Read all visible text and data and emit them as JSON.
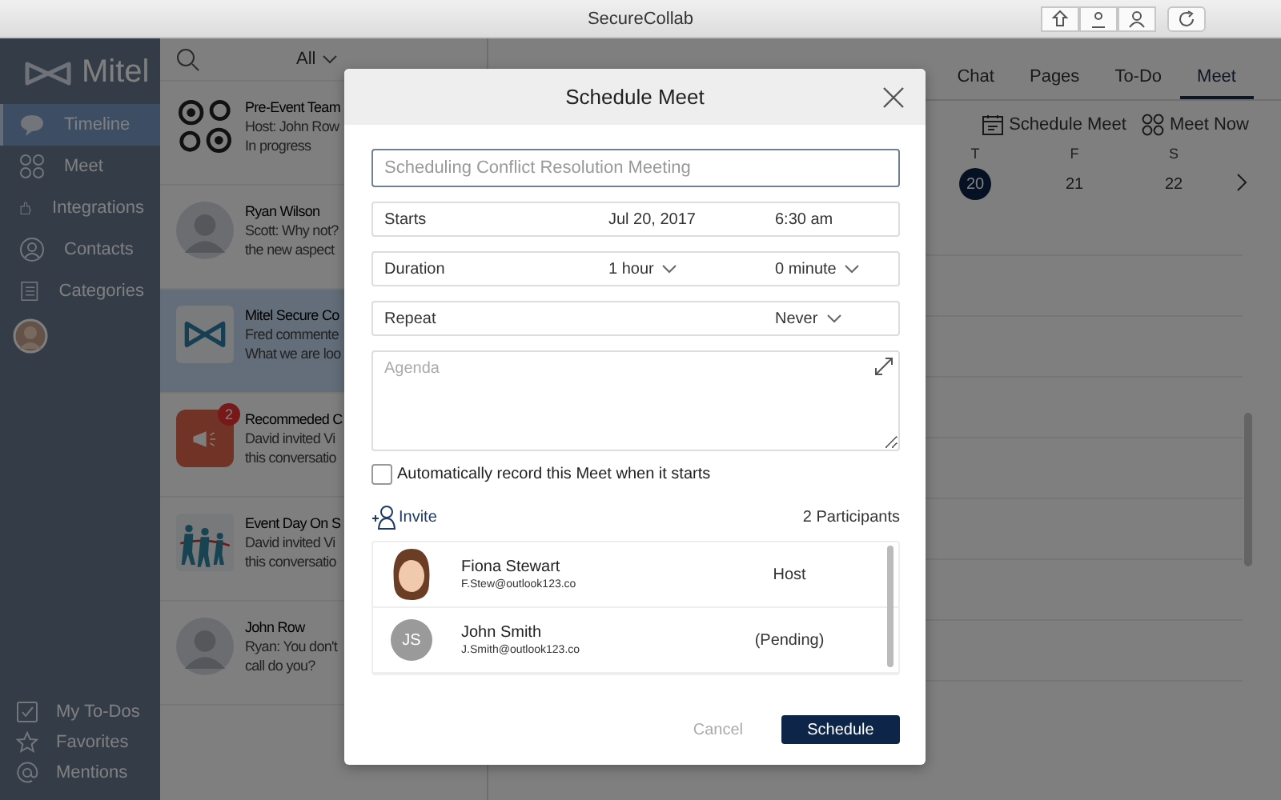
{
  "window": {
    "title": "SecureCollab"
  },
  "sidebar": {
    "logo": "Mitel",
    "items": [
      {
        "label": "Timeline",
        "selected": true
      },
      {
        "label": "Meet",
        "selected": false
      },
      {
        "label": "Integrations",
        "selected": false
      },
      {
        "label": "Contacts",
        "selected": false
      },
      {
        "label": "Categories",
        "selected": false
      }
    ],
    "footer_items": [
      {
        "label": "My To-Dos"
      },
      {
        "label": "Favorites"
      },
      {
        "label": "Mentions"
      }
    ]
  },
  "conversation_list": {
    "filter": "All",
    "items": [
      {
        "kind": "group",
        "title": "Pre-Event Team",
        "lines": [
          "Host: John Row",
          "In progress"
        ],
        "selected": false
      },
      {
        "kind": "person",
        "title": "Ryan Wilson",
        "lines": [
          "Scott: Why not?",
          "the new aspect"
        ],
        "selected": false
      },
      {
        "kind": "app",
        "title": "Mitel Secure Co",
        "lines": [
          "Fred commente",
          "What we are loo"
        ],
        "selected": true
      },
      {
        "kind": "alert",
        "title": "Recommeded C",
        "lines": [
          "David invited Vi",
          "this conversatio"
        ],
        "badge": "2",
        "selected": false
      },
      {
        "kind": "picture",
        "title": "Event Day On S",
        "lines": [
          "David invited Vi",
          "this conversatio"
        ],
        "selected": false
      },
      {
        "kind": "person",
        "title": "John Row",
        "lines": [
          "Ryan: You don't",
          "call do you?"
        ],
        "selected": false
      }
    ]
  },
  "stream": {
    "tabs": [
      {
        "label": "Chat",
        "selected": false
      },
      {
        "label": "Pages",
        "selected": false
      },
      {
        "label": "To-Do",
        "selected": false
      },
      {
        "label": "Meet",
        "selected": true
      }
    ],
    "actions": [
      "Schedule Meet",
      "Meet Now"
    ],
    "calendar": {
      "days": [
        {
          "weekday": "T",
          "date": "20",
          "selected": true
        },
        {
          "weekday": "F",
          "date": "21",
          "selected": false
        },
        {
          "weekday": "S",
          "date": "22",
          "selected": false
        }
      ]
    }
  },
  "dialog": {
    "title": "Schedule Meet",
    "name_field": {
      "placeholder": "Scheduling Conflict Resolution Meeting"
    },
    "rows": [
      {
        "label": "Starts",
        "values": [
          {
            "text": "Jul 20, 2017",
            "dropdown": false
          },
          {
            "text": "6:30 am",
            "dropdown": false
          }
        ]
      },
      {
        "label": "Duration",
        "values": [
          {
            "text": "1 hour",
            "dropdown": true
          },
          {
            "text": "0 minute",
            "dropdown": true
          }
        ]
      },
      {
        "label": "Repeat",
        "values": [
          {
            "text": "Never",
            "dropdown": true
          }
        ]
      }
    ],
    "agenda": {
      "placeholder": "Agenda"
    },
    "auto_record": {
      "label": "Automatically record this Meet when it starts",
      "checked": false
    },
    "invite": "Invite",
    "participant_count": "2 Participants",
    "participants": [
      {
        "name": "Fiona Stewart",
        "email": "F.Stew@outlook123.co",
        "role": "Host"
      },
      {
        "name": "John Smith",
        "email": "J.Smith@outlook123.co",
        "role": "(Pending)",
        "kind": "initials",
        "initials": "JS"
      }
    ],
    "buttons": {
      "cancel": "Cancel",
      "confirm": "Schedule"
    }
  }
}
